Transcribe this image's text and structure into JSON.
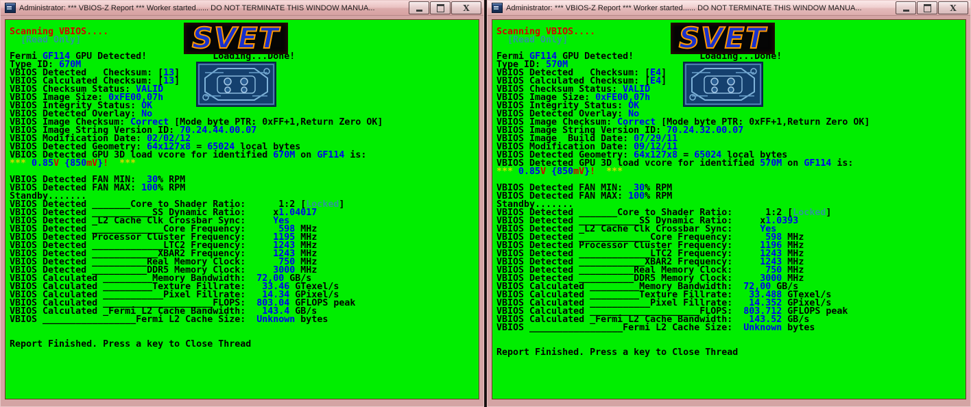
{
  "colors": {
    "console_bg": "#00ee00",
    "text_black": "#000000",
    "text_blue": "#0000f0",
    "text_red": "#d40000",
    "text_yellow": "#d8d800",
    "text_teal": "#2e9898",
    "titlebar_pink": "#e8bcbc",
    "logo_orange": "#ff9800",
    "logo_blue": "#1830cc"
  },
  "windows": [
    {
      "title": "Administrator:  *** VBIOS-Z Report ***  Worker started...... DO NOT TERMINATE THIS WINDOW MANUA...",
      "buttons": {
        "minimize": "minimize",
        "maximize": "maximize",
        "close": "close"
      },
      "logo_text": "SVET",
      "lines": [
        [
          {
            "t": "Scanning VBIOS....",
            "c": "r"
          }
        ],
        [
          {
            "t": "  [Read Only]",
            "c": "t"
          }
        ],
        [],
        [
          {
            "t": "Fermi ",
            "c": "k"
          },
          {
            "t": "GF114",
            "c": "b"
          },
          {
            "t": " GPU Detected!            Loading...Done!",
            "c": "k"
          }
        ],
        [
          {
            "t": "Type ID: ",
            "c": "k"
          },
          {
            "t": "670M",
            "c": "b"
          }
        ],
        [
          {
            "t": "VBIOS Detected   Checksum: [",
            "c": "k"
          },
          {
            "t": "13",
            "c": "b"
          },
          {
            "t": "]",
            "c": "k"
          }
        ],
        [
          {
            "t": "VBIOS Calculated Checksum: [",
            "c": "k"
          },
          {
            "t": "13",
            "c": "b"
          },
          {
            "t": "]",
            "c": "k"
          }
        ],
        [
          {
            "t": "VBIOS Checksum Status: ",
            "c": "k"
          },
          {
            "t": "VALID",
            "c": "b"
          }
        ],
        [
          {
            "t": "VBIOS Image Size: ",
            "c": "k"
          },
          {
            "t": "0xFE00,07h",
            "c": "b"
          }
        ],
        [
          {
            "t": "VBIOS Integrity Status: ",
            "c": "k"
          },
          {
            "t": "OK",
            "c": "b"
          }
        ],
        [
          {
            "t": "VBIOS Detected Overlay: ",
            "c": "k"
          },
          {
            "t": "No",
            "c": "b"
          }
        ],
        [
          {
            "t": "VBIOS Image Checksum: ",
            "c": "k"
          },
          {
            "t": "Correct",
            "c": "b"
          },
          {
            "t": " [Mode byte PTR: 0xFF+1,Return Zero OK]",
            "c": "k"
          }
        ],
        [
          {
            "t": "VBIOS Image String Version ID: ",
            "c": "k"
          },
          {
            "t": "70.24.44.00.07",
            "c": "b"
          }
        ],
        [
          {
            "t": "VBIOS Modification Date: ",
            "c": "k"
          },
          {
            "t": "02/02/12",
            "c": "b"
          }
        ],
        [
          {
            "t": "VBIOS Detected Geometry: ",
            "c": "k"
          },
          {
            "t": "64x127x8",
            "c": "b"
          },
          {
            "t": " = ",
            "c": "k"
          },
          {
            "t": "65024",
            "c": "b"
          },
          {
            "t": " local bytes",
            "c": "k"
          }
        ],
        [
          {
            "t": "VBIOS Detected GPU 3D load vcore for identified ",
            "c": "k"
          },
          {
            "t": "670M",
            "c": "b"
          },
          {
            "t": " on ",
            "c": "k"
          },
          {
            "t": "GF114",
            "c": "b"
          },
          {
            "t": " is:",
            "c": "k"
          }
        ],
        [
          {
            "t": "*** ",
            "c": "y"
          },
          {
            "t": "0.85",
            "c": "b"
          },
          {
            "t": "V",
            "c": "r"
          },
          {
            "t": " {850",
            "c": "b"
          },
          {
            "t": "mV",
            "c": "r"
          },
          {
            "t": "}",
            "c": "b"
          },
          {
            "t": "!",
            "c": "r"
          },
          {
            "t": "  ***",
            "c": "y"
          }
        ],
        [],
        [
          {
            "t": "VBIOS Detected FAN MIN:  ",
            "c": "k"
          },
          {
            "t": "30",
            "c": "b"
          },
          {
            "t": "% RPM",
            "c": "k"
          }
        ],
        [
          {
            "t": "VBIOS Detected FAN MAX: ",
            "c": "k"
          },
          {
            "t": "100",
            "c": "b"
          },
          {
            "t": "% RPM",
            "c": "k"
          }
        ],
        [
          {
            "t": "Standby.......",
            "c": "k"
          }
        ],
        [
          {
            "t": "VBIOS Detected _______Core to Shader Ratio:      1:2 [",
            "c": "k"
          },
          {
            "t": "Locked",
            "c": "t"
          },
          {
            "t": "]",
            "c": "k"
          }
        ],
        [
          {
            "t": "VBIOS Detected ___________SS Dynamic Ratio:     x",
            "c": "k"
          },
          {
            "t": "1.04017",
            "c": "b"
          }
        ],
        [
          {
            "t": "VBIOS Detected _L2 Cache Clk Crossbar Sync:     ",
            "c": "k"
          },
          {
            "t": "Yes",
            "c": "b"
          }
        ],
        [
          {
            "t": "VBIOS Detected _____________Core Frequency:      ",
            "c": "k"
          },
          {
            "t": "598",
            "c": "b"
          },
          {
            "t": " MHz",
            "c": "k"
          }
        ],
        [
          {
            "t": "VBIOS Detected Processor Cluster Frequency:     ",
            "c": "k"
          },
          {
            "t": "1195",
            "c": "b"
          },
          {
            "t": " MHz",
            "c": "k"
          }
        ],
        [
          {
            "t": "VBIOS Detected _____________LTC2 Frequency:     ",
            "c": "k"
          },
          {
            "t": "1243",
            "c": "b"
          },
          {
            "t": " MHz",
            "c": "k"
          }
        ],
        [
          {
            "t": "VBIOS Detected ____________XBAR2 Frequency:     ",
            "c": "k"
          },
          {
            "t": "1243",
            "c": "b"
          },
          {
            "t": " MHz",
            "c": "k"
          }
        ],
        [
          {
            "t": "VBIOS Detected __________Real Memory Clock:      ",
            "c": "k"
          },
          {
            "t": "750",
            "c": "b"
          },
          {
            "t": " MHz",
            "c": "k"
          }
        ],
        [
          {
            "t": "VBIOS Detected __________DDR5 Memory Clock:     ",
            "c": "k"
          },
          {
            "t": "3000",
            "c": "b"
          },
          {
            "t": " MHz",
            "c": "k"
          }
        ],
        [
          {
            "t": "VBIOS Calculated _________Memory Bandwidth:  ",
            "c": "k"
          },
          {
            "t": "72,00",
            "c": "b"
          },
          {
            "t": " GB/s",
            "c": "k"
          }
        ],
        [
          {
            "t": "VBIOS Calculated _________Texture Fillrate:   ",
            "c": "k"
          },
          {
            "t": "33.46",
            "c": "b"
          },
          {
            "t": " GTexel/s",
            "c": "k"
          }
        ],
        [
          {
            "t": "VBIOS Calculated ___________Pixel Fillrate:   ",
            "c": "k"
          },
          {
            "t": "14.34",
            "c": "b"
          },
          {
            "t": " GPixel/s",
            "c": "k"
          }
        ],
        [
          {
            "t": "VBIOS Calculated ____________________FLOPS:  ",
            "c": "k"
          },
          {
            "t": "803.04",
            "c": "b"
          },
          {
            "t": " GFLOPS peak",
            "c": "k"
          }
        ],
        [
          {
            "t": "VBIOS Calculated _Fermi L2 Cache Bandwidth:   ",
            "c": "k"
          },
          {
            "t": "143.4",
            "c": "b"
          },
          {
            "t": " GB/s",
            "c": "k"
          }
        ],
        [
          {
            "t": "VBIOS _________________Fermi L2 Cache Size:  ",
            "c": "k"
          },
          {
            "t": "Unknown",
            "c": "b"
          },
          {
            "t": " bytes",
            "c": "k"
          }
        ],
        [],
        [],
        [
          {
            "t": "Report Finished. Press a key to Close Thread",
            "c": "k"
          }
        ]
      ]
    },
    {
      "title": "Administrator:  *** VBIOS-Z Report ***  Worker started...... DO NOT TERMINATE THIS WINDOW MANUA...",
      "buttons": {
        "minimize": "minimize",
        "maximize": "maximize",
        "close": "close"
      },
      "logo_text": "SVET",
      "lines": [
        [
          {
            "t": "Scanning VBIOS....",
            "c": "r"
          }
        ],
        [
          {
            "t": "  [Read Only]",
            "c": "t"
          }
        ],
        [],
        [
          {
            "t": "Fermi ",
            "c": "k"
          },
          {
            "t": "GF114",
            "c": "b"
          },
          {
            "t": " GPU Detected!            Loading...Done!",
            "c": "k"
          }
        ],
        [
          {
            "t": "Type ID: ",
            "c": "k"
          },
          {
            "t": "570M",
            "c": "b"
          }
        ],
        [
          {
            "t": "VBIOS Detected   Checksum: [",
            "c": "k"
          },
          {
            "t": "E4",
            "c": "b"
          },
          {
            "t": "]",
            "c": "k"
          }
        ],
        [
          {
            "t": "VBIOS Calculated Checksum: [",
            "c": "k"
          },
          {
            "t": "E4",
            "c": "b"
          },
          {
            "t": "]",
            "c": "k"
          }
        ],
        [
          {
            "t": "VBIOS Checksum Status: ",
            "c": "k"
          },
          {
            "t": "VALID",
            "c": "b"
          }
        ],
        [
          {
            "t": "VBIOS Image Size: ",
            "c": "k"
          },
          {
            "t": "0xFE00,07h",
            "c": "b"
          }
        ],
        [
          {
            "t": "VBIOS Integrity Status: ",
            "c": "k"
          },
          {
            "t": "OK",
            "c": "b"
          }
        ],
        [
          {
            "t": "VBIOS Detected Overlay: ",
            "c": "k"
          },
          {
            "t": "No",
            "c": "b"
          }
        ],
        [
          {
            "t": "VBIOS Image Checksum: ",
            "c": "k"
          },
          {
            "t": "Correct",
            "c": "b"
          },
          {
            "t": " [Mode byte PTR: 0xFF+1,Return Zero OK]",
            "c": "k"
          }
        ],
        [
          {
            "t": "VBIOS Image String Version ID: ",
            "c": "k"
          },
          {
            "t": "70.24.32.00.07",
            "c": "b"
          }
        ],
        [
          {
            "t": "VBIOS Image  Build Date: ",
            "c": "k"
          },
          {
            "t": "07/29/11",
            "c": "b"
          }
        ],
        [
          {
            "t": "VBIOS Modification Date: ",
            "c": "k"
          },
          {
            "t": "09/12/11",
            "c": "b"
          }
        ],
        [
          {
            "t": "VBIOS Detected Geometry: ",
            "c": "k"
          },
          {
            "t": "64x127x8",
            "c": "b"
          },
          {
            "t": " = ",
            "c": "k"
          },
          {
            "t": "65024",
            "c": "b"
          },
          {
            "t": " local bytes",
            "c": "k"
          }
        ],
        [
          {
            "t": "VBIOS Detected GPU 3D load vcore for identified ",
            "c": "k"
          },
          {
            "t": "570M",
            "c": "b"
          },
          {
            "t": " on ",
            "c": "k"
          },
          {
            "t": "GF114",
            "c": "b"
          },
          {
            "t": " is:",
            "c": "k"
          }
        ],
        [
          {
            "t": "*** ",
            "c": "y"
          },
          {
            "t": "0.85",
            "c": "b"
          },
          {
            "t": "V",
            "c": "r"
          },
          {
            "t": " {850",
            "c": "b"
          },
          {
            "t": "mV",
            "c": "r"
          },
          {
            "t": "}",
            "c": "b"
          },
          {
            "t": "!",
            "c": "r"
          },
          {
            "t": "  ***",
            "c": "y"
          }
        ],
        [],
        [
          {
            "t": "VBIOS Detected FAN MIN:  ",
            "c": "k"
          },
          {
            "t": "30",
            "c": "b"
          },
          {
            "t": "% RPM",
            "c": "k"
          }
        ],
        [
          {
            "t": "VBIOS Detected FAN MAX: ",
            "c": "k"
          },
          {
            "t": "100",
            "c": "b"
          },
          {
            "t": "% RPM",
            "c": "k"
          }
        ],
        [
          {
            "t": "Standby.......",
            "c": "k"
          }
        ],
        [
          {
            "t": "VBIOS Detected _______Core to Shader Ratio:      1:2 [",
            "c": "k"
          },
          {
            "t": "Locked",
            "c": "t"
          },
          {
            "t": "]",
            "c": "k"
          }
        ],
        [
          {
            "t": "VBIOS Detected ___________SS Dynamic Ratio:     x",
            "c": "k"
          },
          {
            "t": "1.0393",
            "c": "b"
          }
        ],
        [
          {
            "t": "VBIOS Detected _L2 Cache Clk Crossbar Sync:     ",
            "c": "k"
          },
          {
            "t": "Yes",
            "c": "b"
          }
        ],
        [
          {
            "t": "VBIOS Detected _____________Core Frequency:      ",
            "c": "k"
          },
          {
            "t": "598",
            "c": "b"
          },
          {
            "t": " MHz",
            "c": "k"
          }
        ],
        [
          {
            "t": "VBIOS Detected Processor Cluster Frequency:     ",
            "c": "k"
          },
          {
            "t": "1196",
            "c": "b"
          },
          {
            "t": " MHz",
            "c": "k"
          }
        ],
        [
          {
            "t": "VBIOS Detected _____________LTC2 Frequency:     ",
            "c": "k"
          },
          {
            "t": "1243",
            "c": "b"
          },
          {
            "t": " MHz",
            "c": "k"
          }
        ],
        [
          {
            "t": "VBIOS Detected ____________XBAR2 Frequency:     ",
            "c": "k"
          },
          {
            "t": "1243",
            "c": "b"
          },
          {
            "t": " MHz",
            "c": "k"
          }
        ],
        [
          {
            "t": "VBIOS Detected __________Real Memory Clock:      ",
            "c": "k"
          },
          {
            "t": "750",
            "c": "b"
          },
          {
            "t": " MHz",
            "c": "k"
          }
        ],
        [
          {
            "t": "VBIOS Detected __________DDR5 Memory Clock:     ",
            "c": "k"
          },
          {
            "t": "3000",
            "c": "b"
          },
          {
            "t": " MHz",
            "c": "k"
          }
        ],
        [
          {
            "t": "VBIOS Calculated _________Memory Bandwidth:  ",
            "c": "k"
          },
          {
            "t": "72,00",
            "c": "b"
          },
          {
            "t": " GB/s",
            "c": "k"
          }
        ],
        [
          {
            "t": "VBIOS Calculated _________Texture Fillrate:   ",
            "c": "k"
          },
          {
            "t": "33.488",
            "c": "b"
          },
          {
            "t": " GTexel/s",
            "c": "k"
          }
        ],
        [
          {
            "t": "VBIOS Calculated ___________Pixel Fillrate:   ",
            "c": "k"
          },
          {
            "t": "14.352",
            "c": "b"
          },
          {
            "t": " GPixel/s",
            "c": "k"
          }
        ],
        [
          {
            "t": "VBIOS Calculated ____________________FLOPS:  ",
            "c": "k"
          },
          {
            "t": "803.712",
            "c": "b"
          },
          {
            "t": " GFLOPS peak",
            "c": "k"
          }
        ],
        [
          {
            "t": "VBIOS Calculated _Fermi L2 Cache Bandwidth:   ",
            "c": "k"
          },
          {
            "t": "143.52",
            "c": "b"
          },
          {
            "t": " GB/s",
            "c": "k"
          }
        ],
        [
          {
            "t": "VBIOS _________________Fermi L2 Cache Size:  ",
            "c": "k"
          },
          {
            "t": "Unknown",
            "c": "b"
          },
          {
            "t": " bytes",
            "c": "k"
          }
        ],
        [],
        [],
        [
          {
            "t": "Report Finished. Press a key to Close Thread",
            "c": "k"
          }
        ]
      ]
    }
  ]
}
